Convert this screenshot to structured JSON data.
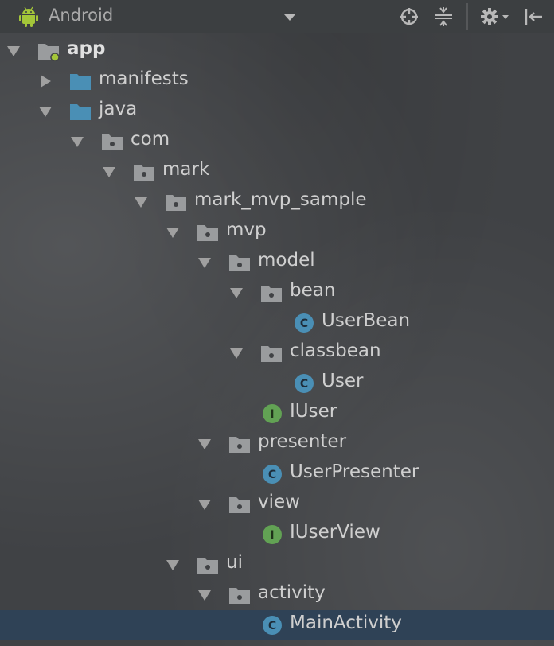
{
  "toolbar": {
    "view_title": "Android",
    "icons": [
      "android-icon",
      "dropdown-icon",
      "locate-icon",
      "collapse-icon",
      "gear-icon",
      "hide-panel-icon"
    ]
  },
  "tree": {
    "app": "app",
    "manifests": "manifests",
    "java": "java",
    "com": "com",
    "mark": "mark",
    "mark_mvp_sample": "mark_mvp_sample",
    "mvp": "mvp",
    "model": "model",
    "bean": "bean",
    "UserBean": "UserBean",
    "classbean": "classbean",
    "User": "User",
    "IUser": "IUser",
    "presenter": "presenter",
    "UserPresenter": "UserPresenter",
    "view": "view",
    "IUserView": "IUserView",
    "ui": "ui",
    "activity": "activity",
    "MainActivity": "MainActivity"
  },
  "badges": {
    "class_letter": "C",
    "interface_letter": "I"
  },
  "colors": {
    "class_badge": "#4a8fb5",
    "interface_badge": "#62a254",
    "folder_blue": "#4a8fb5",
    "package_gray": "#9a9c9e",
    "selected_row": "#2f4256",
    "android_green": "#a4c639"
  },
  "selected": "MainActivity"
}
